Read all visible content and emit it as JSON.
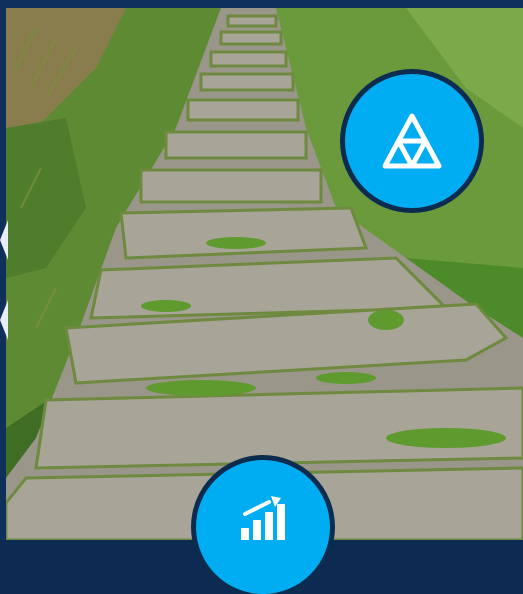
{
  "icons": {
    "top_badge": "triforce-triangle-icon",
    "bottom_badge": "growth-chart-icon",
    "left_nav": "chevron-left-icon"
  },
  "colors": {
    "frame": "#10305c",
    "badge_fill": "#00adf2",
    "badge_ring": "#0b2c4f",
    "icon_stroke": "#ffffff"
  }
}
